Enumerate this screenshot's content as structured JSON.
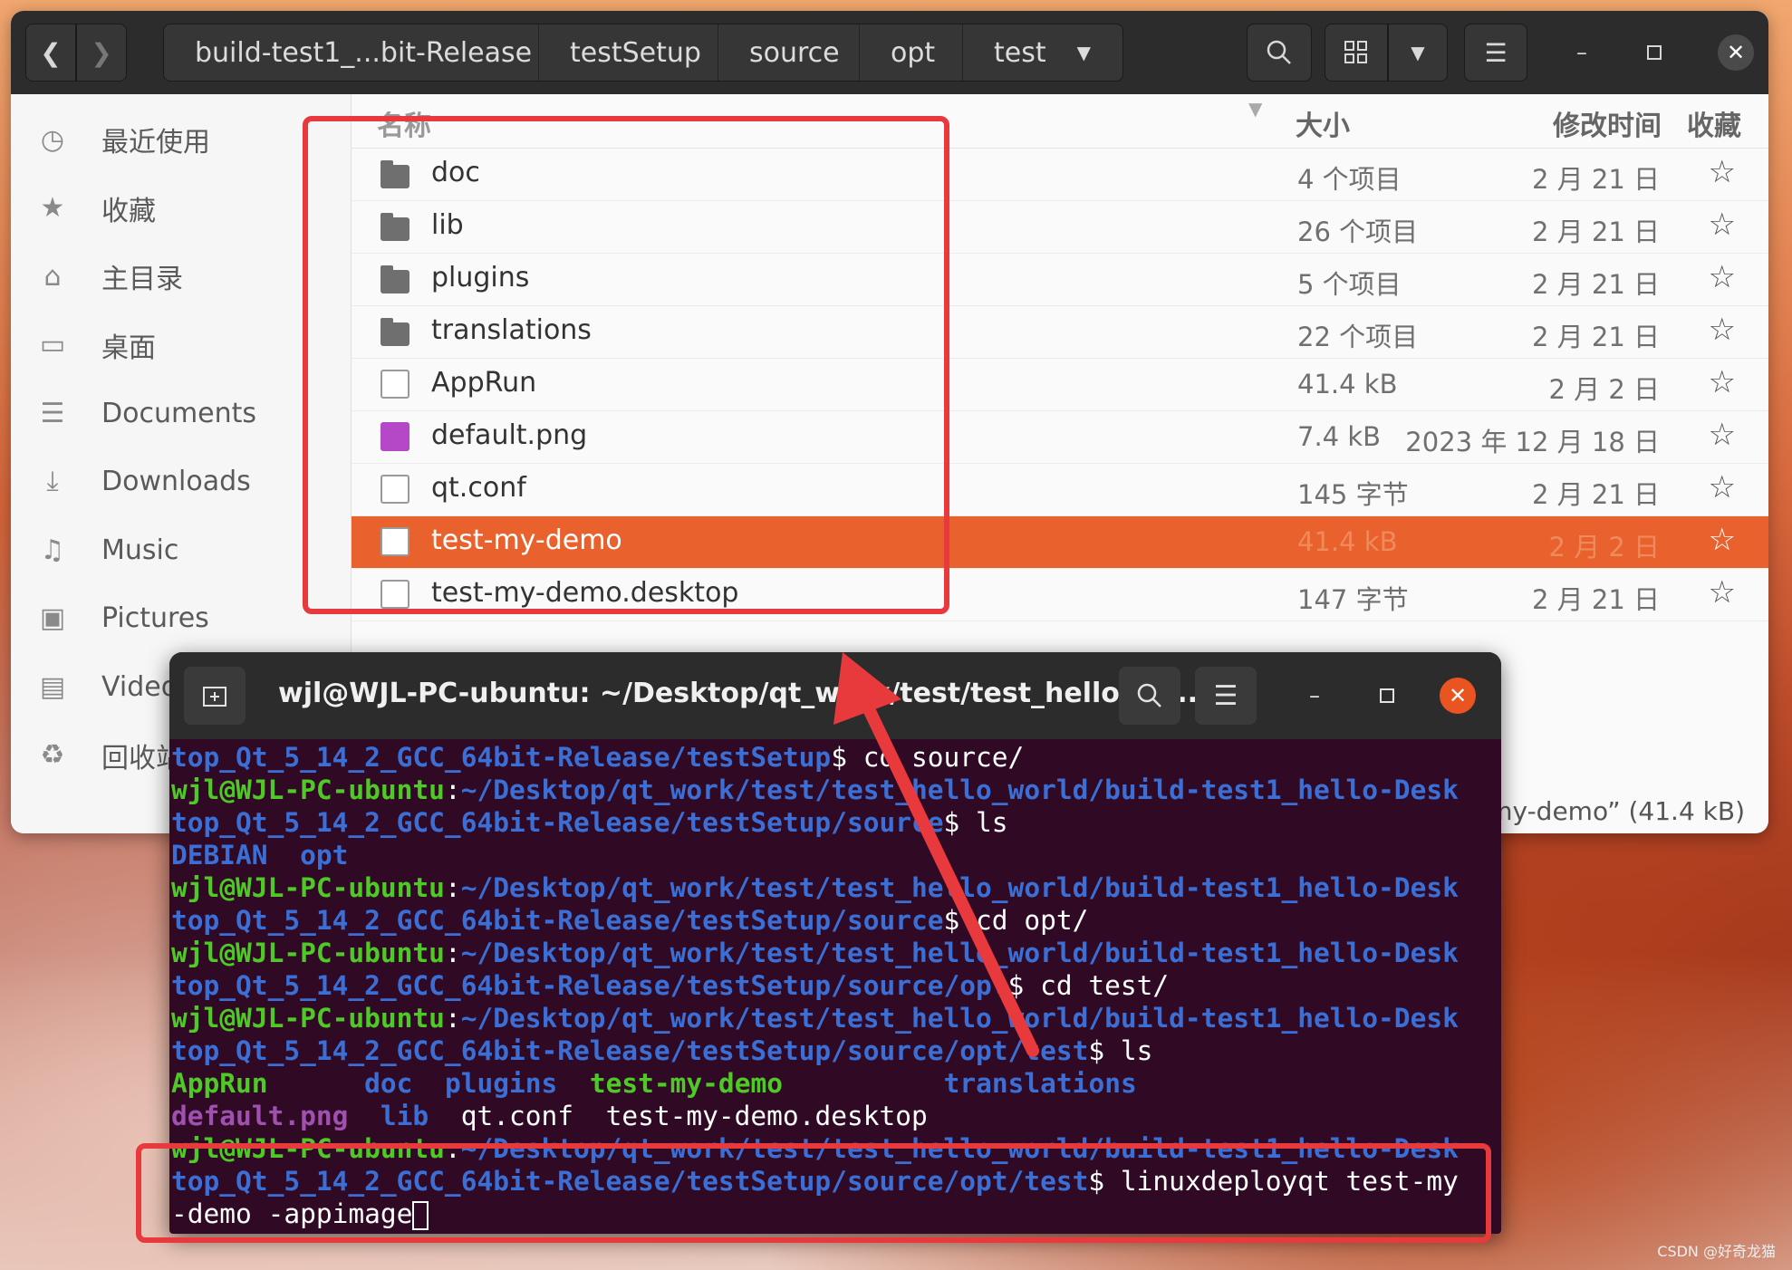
{
  "file_manager": {
    "nav": {
      "back_icon": "chevron-left-icon",
      "forward_icon": "chevron-right-icon"
    },
    "breadcrumbs": [
      "build-test1_...bit-Release",
      "testSetup",
      "source",
      "opt",
      "test"
    ],
    "sidebar": [
      {
        "icon": "clock-icon",
        "label": "最近使用"
      },
      {
        "icon": "star-icon",
        "label": "收藏"
      },
      {
        "icon": "home-icon",
        "label": "主目录"
      },
      {
        "icon": "desktop-icon",
        "label": "桌面"
      },
      {
        "icon": "document-icon",
        "label": "Documents"
      },
      {
        "icon": "download-icon",
        "label": "Downloads"
      },
      {
        "icon": "music-icon",
        "label": "Music"
      },
      {
        "icon": "picture-icon",
        "label": "Pictures"
      },
      {
        "icon": "video-icon",
        "label": "Videos"
      },
      {
        "icon": "trash-icon",
        "label": "回收站"
      }
    ],
    "columns": {
      "name": "名称",
      "size": "大小",
      "modified": "修改时间",
      "starred": "收藏"
    },
    "files": [
      {
        "name": "doc",
        "size": "4 个项目",
        "date": "2 月 21 日",
        "type": "folder"
      },
      {
        "name": "lib",
        "size": "26 个项目",
        "date": "2 月 21 日",
        "type": "folder"
      },
      {
        "name": "plugins",
        "size": "5 个项目",
        "date": "2 月 21 日",
        "type": "folder"
      },
      {
        "name": "translations",
        "size": "22 个项目",
        "date": "2 月 21 日",
        "type": "folder"
      },
      {
        "name": "AppRun",
        "size": "41.4 kB",
        "date": "2 月 2 日",
        "type": "link"
      },
      {
        "name": "default.png",
        "size": "7.4 kB",
        "date": "2023 年 12 月 18 日",
        "type": "image"
      },
      {
        "name": "qt.conf",
        "size": "145 字节",
        "date": "2 月 21 日",
        "type": "text"
      },
      {
        "name": "test-my-demo",
        "size": "41.4 kB",
        "date": "2 月 2 日",
        "type": "exec",
        "selected": true
      },
      {
        "name": "test-my-demo.desktop",
        "size": "147 字节",
        "date": "2 月 21 日",
        "type": "desktop"
      }
    ],
    "status": "-my-demo” (41.4 kB)"
  },
  "terminal": {
    "title": "wjl@WJL-PC-ubuntu: ~/Desktop/qt_work/test/test_hello_wo...",
    "lines": [
      [
        {
          "c": "b",
          "t": "top_Qt_5_14_2_GCC_64bit-Release/testSetup"
        },
        {
          "c": "w",
          "t": "$ cd source/"
        }
      ],
      [
        {
          "c": "g",
          "t": "wjl@WJL-PC-ubuntu"
        },
        {
          "c": "w",
          "t": ":"
        },
        {
          "c": "b",
          "t": "~/Desktop/qt_work/test/test_hello_world/build-test1_hello-Desk"
        }
      ],
      [
        {
          "c": "b",
          "t": "top_Qt_5_14_2_GCC_64bit-Release/testSetup/source"
        },
        {
          "c": "w",
          "t": "$ ls"
        }
      ],
      [
        {
          "c": "b",
          "t": "DEBIAN  opt"
        }
      ],
      [
        {
          "c": "g",
          "t": "wjl@WJL-PC-ubuntu"
        },
        {
          "c": "w",
          "t": ":"
        },
        {
          "c": "b",
          "t": "~/Desktop/qt_work/test/test_hello_world/build-test1_hello-Desk"
        }
      ],
      [
        {
          "c": "b",
          "t": "top_Qt_5_14_2_GCC_64bit-Release/testSetup/source"
        },
        {
          "c": "w",
          "t": "$ cd opt/"
        }
      ],
      [
        {
          "c": "g",
          "t": "wjl@WJL-PC-ubuntu"
        },
        {
          "c": "w",
          "t": ":"
        },
        {
          "c": "b",
          "t": "~/Desktop/qt_work/test/test_hello_world/build-test1_hello-Desk"
        }
      ],
      [
        {
          "c": "b",
          "t": "top_Qt_5_14_2_GCC_64bit-Release/testSetup/source/opt"
        },
        {
          "c": "w",
          "t": "$ cd test/"
        }
      ],
      [
        {
          "c": "g",
          "t": "wjl@WJL-PC-ubuntu"
        },
        {
          "c": "w",
          "t": ":"
        },
        {
          "c": "b",
          "t": "~/Desktop/qt_work/test/test_hello_world/build-test1_hello-Desk"
        }
      ],
      [
        {
          "c": "b",
          "t": "top_Qt_5_14_2_GCC_64bit-Release/testSetup/source/opt/test"
        },
        {
          "c": "w",
          "t": "$ ls"
        }
      ],
      [
        {
          "c": "g",
          "t": "AppRun"
        },
        {
          "c": "w",
          "t": "      "
        },
        {
          "c": "b",
          "t": "doc"
        },
        {
          "c": "w",
          "t": "  "
        },
        {
          "c": "b",
          "t": "plugins"
        },
        {
          "c": "w",
          "t": "  "
        },
        {
          "c": "g",
          "t": "test-my-demo"
        },
        {
          "c": "w",
          "t": "          "
        },
        {
          "c": "b",
          "t": "translations"
        }
      ],
      [
        {
          "c": "m",
          "t": "default.png"
        },
        {
          "c": "w",
          "t": "  "
        },
        {
          "c": "b",
          "t": "lib"
        },
        {
          "c": "w",
          "t": "  qt.conf  test-my-demo.desktop"
        }
      ],
      [
        {
          "c": "g",
          "t": "wjl@WJL-PC-ubuntu"
        },
        {
          "c": "w",
          "t": ":"
        },
        {
          "c": "b",
          "t": "~/Desktop/qt_work/test/test_hello_world/build-test1_hello-Desk"
        }
      ],
      [
        {
          "c": "b",
          "t": "top_Qt_5_14_2_GCC_64bit-Release/testSetup/source/opt/test"
        },
        {
          "c": "w",
          "t": "$ linuxdeployqt test-my"
        }
      ],
      [
        {
          "c": "w",
          "t": "-demo -appimage"
        }
      ]
    ]
  },
  "watermark": "CSDN @好奇龙猫",
  "colors": {
    "selection": "#e9622d",
    "annotation_red": "#e8393c",
    "terminal_bg": "#300a24"
  }
}
